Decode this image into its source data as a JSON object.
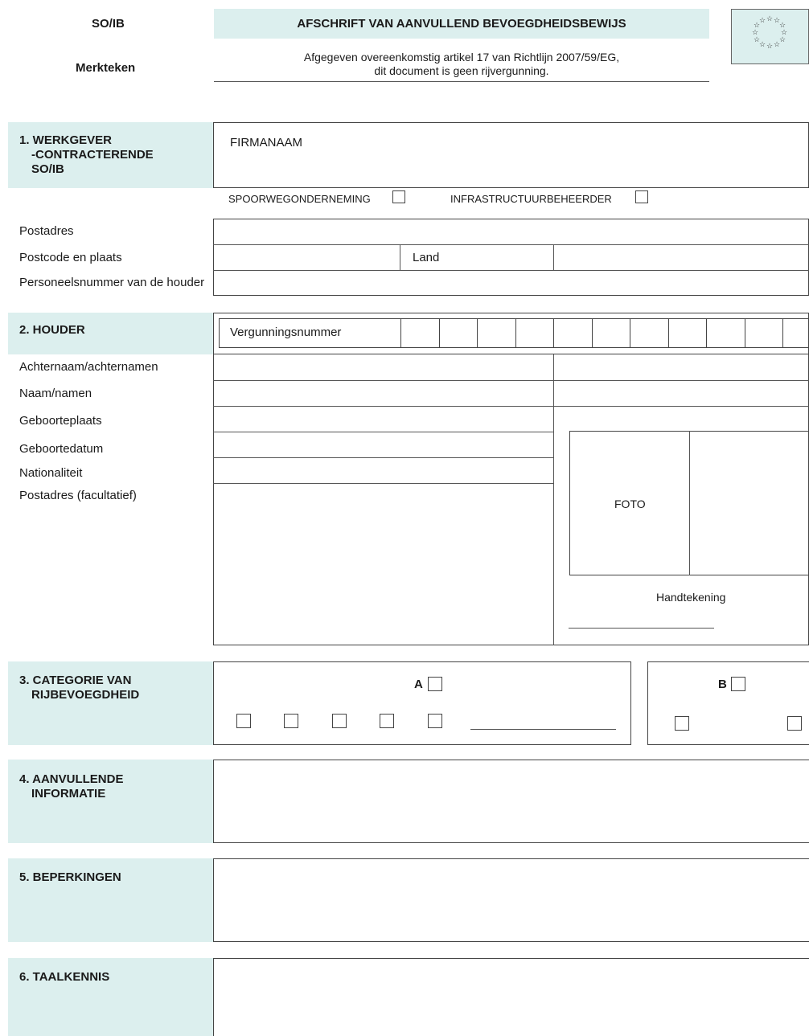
{
  "header": {
    "left_top": "SO/IB",
    "left_bottom": "Merkteken",
    "title": "AFSCHRIFT VAN AANVULLEND BEVOEGDHEIDSBEWIJS",
    "subtitle_line1": "Afgegeven overeenkomstig artikel 17 van Richtlijn 2007/59/EG,",
    "subtitle_line2": "dit document is geen rijvergunning.",
    "flag_icon": "eu-stars-icon",
    "band_color": "#dcefee"
  },
  "section1": {
    "title_line1": "1. WERKGEVER",
    "title_line2": "-CONTRACTERENDE",
    "title_line3": "SO/IB",
    "company_label": "FIRMANAAM",
    "option_railway": "SPOORWEGONDERNEMING",
    "option_infra": "INFRASTRUCTUURBEHEERDER",
    "postal_address": "Postadres",
    "postcode_city": "Postcode en plaats",
    "country": "Land",
    "personnel_number": "Personeelsnummer van de houder"
  },
  "section2": {
    "title": "2. HOUDER",
    "license_number": "Vergunningsnummer",
    "surname": "Achternaam/achternamen",
    "names": "Naam/namen",
    "birthplace": "Geboorteplaats",
    "birthdate": "Geboortedatum",
    "nationality": "Nationaliteit",
    "postal_optional": "Postadres (facultatief)",
    "photo": "FOTO",
    "signature": "Handtekening"
  },
  "section3": {
    "title_line1": "3. CATEGORIE VAN",
    "title_line2": "RIJBEVOEGDHEID",
    "cat_a": "A",
    "cat_b": "B"
  },
  "section4": {
    "title_line1": "4. AANVULLENDE",
    "title_line2": "INFORMATIE"
  },
  "section5": {
    "title": "5. BEPERKINGEN"
  },
  "section6": {
    "title": "6. TAALKENNIS"
  }
}
